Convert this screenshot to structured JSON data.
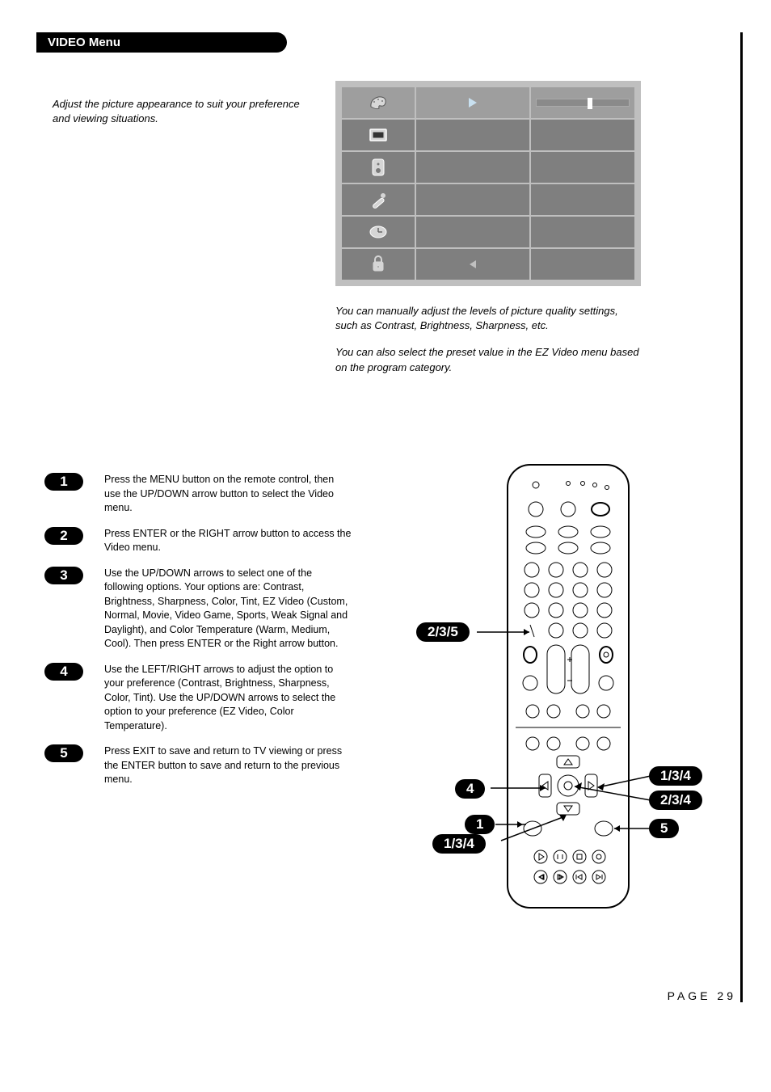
{
  "header": {
    "title": "VIDEO Menu"
  },
  "intro": "Adjust the picture appearance to suit your preference and viewing situations.",
  "osd_captions": {
    "p1": "You can manually adjust the levels of picture quality settings, such as Contrast, Brightness, Sharpness, etc.",
    "p2": "You can also select the preset value in the EZ Video menu based on the program category."
  },
  "steps": [
    {
      "n": "1",
      "text": "Press the MENU button on the remote control, then use the UP/DOWN arrow button to select the Video menu."
    },
    {
      "n": "2",
      "text": "Press ENTER or the RIGHT arrow button to access the Video menu."
    },
    {
      "n": "3",
      "text": "Use the UP/DOWN arrows to select one of the following options. Your options are: Contrast, Brightness, Sharpness, Color, Tint, EZ Video (Custom, Normal, Movie, Video Game, Sports, Weak Signal and Daylight), and Color Temperature (Warm, Medium, Cool). Then press ENTER or the Right arrow button."
    },
    {
      "n": "4",
      "text": "Use the LEFT/RIGHT arrows to adjust the option to your preference (Contrast, Brightness, Sharpness, Color, Tint). Use the UP/DOWN arrows to select the option to your preference (EZ Video, Color Temperature)."
    },
    {
      "n": "5",
      "text": "Press EXIT to save and return to TV viewing or press the ENTER button to save and return to the previous menu."
    }
  ],
  "callouts": {
    "c235_left": "2/3/5",
    "c4_left": "4",
    "c1_left": "1",
    "c134_bottom": "1/3/4",
    "c134_right": "1/3/4",
    "c234_right": "2/3/4",
    "c5_right": "5"
  },
  "page_number": "PAGE 29"
}
